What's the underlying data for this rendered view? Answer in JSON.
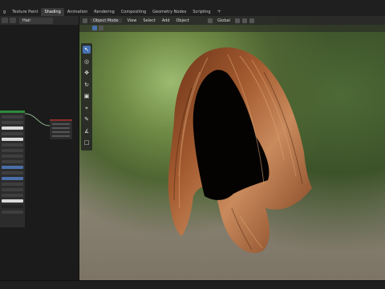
{
  "workspace_tabs": [
    "g",
    "Texture Paint",
    "Shading",
    "Animation",
    "Rendering",
    "Compositing",
    "Geometry Nodes",
    "Scripting"
  ],
  "active_tab": "Shading",
  "tab_add": "+",
  "node_editor": {
    "material_name": "Hair"
  },
  "viewport_header": {
    "mode": "Object Mode",
    "menus": [
      "View",
      "Select",
      "Add",
      "Object"
    ],
    "transform_orientation": "Global"
  },
  "toolbar": {
    "tools": [
      "select-tool",
      "cursor-tool",
      "move-tool",
      "rotate-tool",
      "scale-tool",
      "transform-tool",
      "annotate-tool",
      "measure-tool",
      "add-cube-tool"
    ],
    "active_index": 0
  },
  "colors": {
    "hair_dark": "#4a2312",
    "hair_mid": "#8d4a26",
    "hair_light": "#c9875a",
    "select_blue": "#4772b3",
    "bsdf_green": "#2d8a3a"
  }
}
